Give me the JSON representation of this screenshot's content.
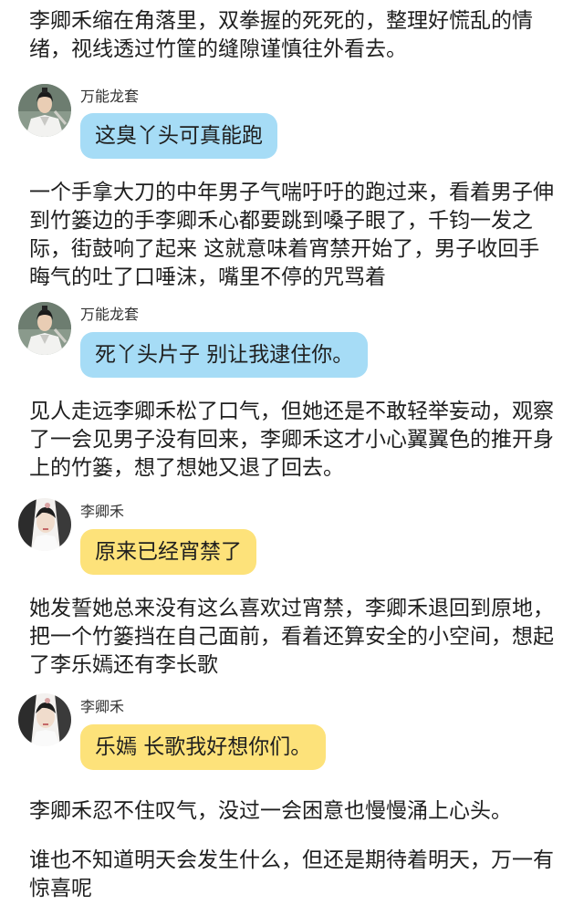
{
  "characters": {
    "wanneng": {
      "name": "万能龙套",
      "bubble_color": "#a6dcf6",
      "avatar_icon": "ancient-male-costume-avatar-icon"
    },
    "liqinghe": {
      "name": "李卿禾",
      "bubble_color": "#fde27a",
      "avatar_icon": "ancient-female-costume-avatar-icon"
    }
  },
  "story": {
    "p1": "李卿禾缩在角落里，双拳握的死死的，整理好慌乱的情绪，视线透过竹筐的缝隙谨慎往外看去。",
    "d1": "这臭丫头可真能跑",
    "p2": "一个手拿大刀的中年男子气喘吁吁的跑过来，看着男子伸到竹篓边的手李卿禾心都要跳到嗓子眼了，千钧一发之际，街鼓响了起来 这就意味着宵禁开始了，男子收回手晦气的吐了口唾沫，嘴里不停的咒骂着",
    "d2": "死丫头片子 别让我逮住你。",
    "p3": "见人走远李卿禾松了口气，但她还是不敢轻举妄动，观察了一会见男子没有回来，李卿禾这才小心翼翼色的推开身上的竹篓，想了想她又退了回去。",
    "d3": "原来已经宵禁了",
    "p4": "她发誓她总来没有这么喜欢过宵禁，李卿禾退回到原地，把一个竹篓挡在自己面前，看着还算安全的小空间，想起了李乐嫣还有李长歌",
    "d4": "乐嫣 长歌我好想你们。",
    "p5": "李卿禾忍不住叹气，没过一会困意也慢慢涌上心头。",
    "p6": "谁也不知道明天会发生什么，但还是期待着明天，万一有惊喜呢"
  }
}
